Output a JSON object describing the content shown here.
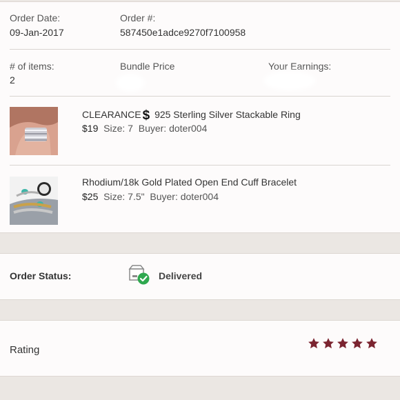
{
  "order": {
    "date_label": "Order Date:",
    "date_value": "09-Jan-2017",
    "number_label": "Order #:",
    "number_value": "587450e1adce9270f7100958",
    "items_label": "# of items:",
    "items_value": "2",
    "bundle_price_label": "Bundle Price",
    "earnings_label": "Your Earnings:"
  },
  "items": [
    {
      "title_prefix": "CLEARANCE",
      "title_icon": "dollar-icon",
      "title": "925 Sterling Silver Stackable Ring",
      "price": "$19",
      "size": "Size: 7",
      "buyer": "Buyer: doter004"
    },
    {
      "title": "Rhodium/18k Gold Plated Open End Cuff Bracelet",
      "price": "$25",
      "size": "Size: 7.5\"",
      "buyer": "Buyer: doter004"
    }
  ],
  "status": {
    "label": "Order Status:",
    "value": "Delivered",
    "icon": "delivered-box-icon",
    "accent": "#2fa84f"
  },
  "rating": {
    "label": "Rating",
    "stars": 5,
    "max_stars": 5,
    "star_color": "#7b2430"
  }
}
